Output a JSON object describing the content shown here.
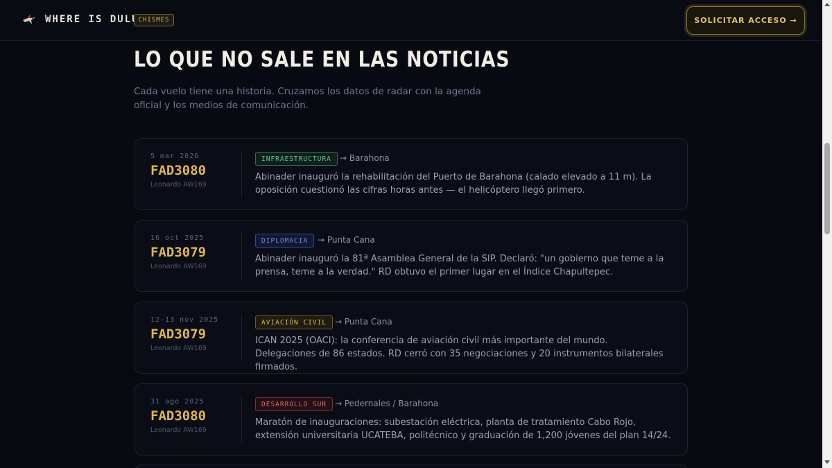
{
  "header": {
    "brand": "WHERE IS DULUS",
    "tag": "CHISMES",
    "cta": "SOLICITAR ACCESO →",
    "logo_icon": "bird-icon"
  },
  "main": {
    "title": "LO QUE NO SALE EN LAS NOTICIAS",
    "subtitle": "Cada vuelo tiene una historia. Cruzamos los datos de radar con la agenda oficial y los medios de comunicación."
  },
  "cards": [
    {
      "date": "5 mar 2026",
      "flight": "FAD3080",
      "aircraft": "Leonardo AW169",
      "badge": "INFRAESTRUCTURA",
      "destination": "→ Barahona",
      "body": "Abinader inauguró la rehabilitación del Puerto de Barahona (calado elevado a 11 m). La oposición cuestionó las cifras horas antes — el helicóptero llegó primero."
    },
    {
      "date": "16 oct 2025",
      "flight": "FAD3079",
      "aircraft": "Leonardo AW169",
      "badge": "DIPLOMACIA",
      "destination": "→ Punta Cana",
      "body": "Abinader inauguró la 81ª Asamblea General de la SIP. Declaró: \"un gobierno que teme a la prensa, teme a la verdad.\" RD obtuvo el primer lugar en el Índice Chapultepec."
    },
    {
      "date": "12-13 nov 2025",
      "flight": "FAD3079",
      "aircraft": "Leonardo AW169",
      "badge": "AVIACIÓN CIVIL",
      "destination": "→ Punta Cana",
      "body": "ICAN 2025 (OACI): la conferencia de aviación civil más importante del mundo. Delegaciones de 86 estados. RD cerró con 35 negociaciones y 20 instrumentos bilaterales firmados."
    },
    {
      "date": "31 ago 2025",
      "flight": "FAD3080",
      "aircraft": "Leonardo AW169",
      "badge": "DESARROLLO SUR",
      "destination": "→ Pedernales / Barahona",
      "body": "Maratón de inauguraciones: subestación eléctrica, planta de tratamiento Cabo Rojo, extensión universitaria UCATEBA, politécnico y graduación de 1,200 jóvenes del plan 14/24."
    }
  ],
  "colors": {
    "accent": "#e0b652",
    "background": "#080a12",
    "infra": "#5fc7a4",
    "diplomacia": "#6d8ce2",
    "aviacion": "#d8b452",
    "desarrollo": "#e06a71"
  }
}
